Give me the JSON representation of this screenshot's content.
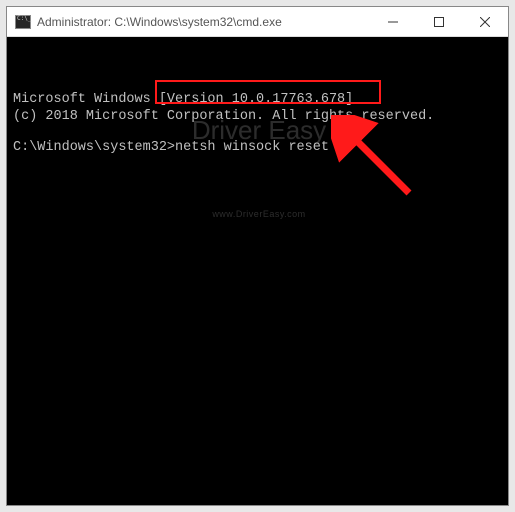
{
  "titlebar": {
    "text": "Administrator: C:\\Windows\\system32\\cmd.exe"
  },
  "terminal": {
    "version_line": "Microsoft Windows [Version 10.0.17763.678]",
    "copyright_line": "(c) 2018 Microsoft Corporation. All rights reserved.",
    "prompt": "C:\\Windows\\system32>",
    "command": "netsh winsock reset"
  },
  "watermark": {
    "main": "Driver Easy",
    "sub": "www.DriverEasy.com"
  },
  "annotation": {
    "color": "#ff1a1a"
  }
}
